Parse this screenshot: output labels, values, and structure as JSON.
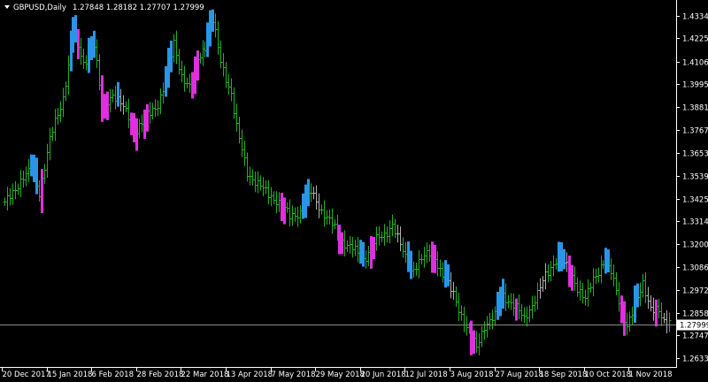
{
  "header": {
    "symbol": "GBPUSD,Daily",
    "ohlc": "1.27848 1.28182 1.27707 1.27999"
  },
  "colors": {
    "background": "#000000",
    "bar_normal": "#22b122",
    "bar_up_signal": "#2a95e6",
    "bar_down_signal": "#e02ee0",
    "bar_neutral": "#b0b0b0",
    "axis": "#ffffff",
    "current_price_line": "#8a8a8a",
    "current_price_label_bg": "#ffffff",
    "current_price_label_text": "#000000"
  },
  "chart_data": {
    "type": "ohlc",
    "ylim": [
      1.2595,
      1.4405
    ],
    "price_ticks": [
      "1.43347",
      "1.42257",
      "1.41067",
      "1.39957",
      "1.38817",
      "1.37677",
      "1.36537",
      "1.35397",
      "1.34257",
      "1.33147",
      "1.32007",
      "1.30867",
      "1.29727",
      "1.28587",
      "1.27477",
      "1.26337"
    ],
    "current_price": "1.27999",
    "date_ticks": [
      "20 Dec 2017",
      "15 Jan 2018",
      "6 Feb 2018",
      "28 Feb 2018",
      "22 Mar 2018",
      "13 Apr 2018",
      "7 May 2018",
      "29 May 2018",
      "20 Jun 2018",
      "12 Jul 2018",
      "3 Aug 2018",
      "27 Aug 2018",
      "18 Sep 2018",
      "10 Oct 2018",
      "1 Nov 2018"
    ],
    "anchors": [
      {
        "i": 0,
        "p": 1.34
      },
      {
        "i": 6,
        "p": 1.352
      },
      {
        "i": 10,
        "p": 1.357
      },
      {
        "i": 13,
        "p": 1.346
      },
      {
        "i": 17,
        "p": 1.372
      },
      {
        "i": 22,
        "p": 1.393
      },
      {
        "i": 26,
        "p": 1.426
      },
      {
        "i": 30,
        "p": 1.41
      },
      {
        "i": 34,
        "p": 1.419
      },
      {
        "i": 37,
        "p": 1.389
      },
      {
        "i": 41,
        "p": 1.395
      },
      {
        "i": 46,
        "p": 1.386
      },
      {
        "i": 50,
        "p": 1.377
      },
      {
        "i": 54,
        "p": 1.384
      },
      {
        "i": 58,
        "p": 1.39
      },
      {
        "i": 61,
        "p": 1.401
      },
      {
        "i": 64,
        "p": 1.42
      },
      {
        "i": 67,
        "p": 1.404
      },
      {
        "i": 70,
        "p": 1.398
      },
      {
        "i": 73,
        "p": 1.412
      },
      {
        "i": 76,
        "p": 1.419
      },
      {
        "i": 79,
        "p": 1.431
      },
      {
        "i": 82,
        "p": 1.411
      },
      {
        "i": 86,
        "p": 1.395
      },
      {
        "i": 88,
        "p": 1.378
      },
      {
        "i": 92,
        "p": 1.356
      },
      {
        "i": 96,
        "p": 1.35
      },
      {
        "i": 100,
        "p": 1.345
      },
      {
        "i": 104,
        "p": 1.341
      },
      {
        "i": 108,
        "p": 1.334
      },
      {
        "i": 112,
        "p": 1.336
      },
      {
        "i": 116,
        "p": 1.346
      },
      {
        "i": 120,
        "p": 1.337
      },
      {
        "i": 124,
        "p": 1.33
      },
      {
        "i": 128,
        "p": 1.322
      },
      {
        "i": 132,
        "p": 1.318
      },
      {
        "i": 136,
        "p": 1.312
      },
      {
        "i": 140,
        "p": 1.322
      },
      {
        "i": 144,
        "p": 1.324
      },
      {
        "i": 147,
        "p": 1.331
      },
      {
        "i": 151,
        "p": 1.316
      },
      {
        "i": 154,
        "p": 1.307
      },
      {
        "i": 158,
        "p": 1.313
      },
      {
        "i": 162,
        "p": 1.316
      },
      {
        "i": 166,
        "p": 1.305
      },
      {
        "i": 170,
        "p": 1.295
      },
      {
        "i": 173,
        "p": 1.285
      },
      {
        "i": 176,
        "p": 1.276
      },
      {
        "i": 179,
        "p": 1.269
      },
      {
        "i": 182,
        "p": 1.28
      },
      {
        "i": 186,
        "p": 1.284
      },
      {
        "i": 189,
        "p": 1.295
      },
      {
        "i": 193,
        "p": 1.29
      },
      {
        "i": 197,
        "p": 1.283
      },
      {
        "i": 201,
        "p": 1.293
      },
      {
        "i": 205,
        "p": 1.304
      },
      {
        "i": 209,
        "p": 1.313
      },
      {
        "i": 213,
        "p": 1.309
      },
      {
        "i": 217,
        "p": 1.299
      },
      {
        "i": 220,
        "p": 1.293
      },
      {
        "i": 223,
        "p": 1.302
      },
      {
        "i": 227,
        "p": 1.312
      },
      {
        "i": 230,
        "p": 1.306
      },
      {
        "i": 233,
        "p": 1.292
      },
      {
        "i": 236,
        "p": 1.28
      },
      {
        "i": 239,
        "p": 1.289
      },
      {
        "i": 242,
        "p": 1.301
      },
      {
        "i": 245,
        "p": 1.289
      },
      {
        "i": 248,
        "p": 1.286
      },
      {
        "i": 250,
        "p": 1.281
      },
      {
        "i": 252,
        "p": 1.283
      }
    ],
    "num_bars": 253,
    "signals_up": [
      [
        10,
        12
      ],
      [
        25,
        27
      ],
      [
        32,
        34
      ],
      [
        43,
        43
      ],
      [
        61,
        63
      ],
      [
        77,
        79
      ],
      [
        113,
        115
      ],
      [
        135,
        136
      ],
      [
        153,
        154
      ],
      [
        167,
        168
      ],
      [
        187,
        189
      ],
      [
        210,
        212
      ],
      [
        228,
        229
      ],
      [
        239,
        240
      ]
    ],
    "signals_down": [
      [
        14,
        14
      ],
      [
        28,
        28
      ],
      [
        37,
        39
      ],
      [
        48,
        50
      ],
      [
        53,
        54
      ],
      [
        71,
        73
      ],
      [
        105,
        106
      ],
      [
        127,
        128
      ],
      [
        139,
        140
      ],
      [
        162,
        163
      ],
      [
        177,
        178
      ],
      [
        187,
        187
      ],
      [
        194,
        194
      ],
      [
        214,
        215
      ],
      [
        234,
        235
      ],
      [
        247,
        247
      ]
    ],
    "neutral_bars": [
      [
        44,
        45
      ],
      [
        78,
        79
      ],
      [
        117,
        119
      ],
      [
        149,
        150
      ],
      [
        169,
        170
      ],
      [
        203,
        205
      ],
      [
        213,
        214
      ],
      [
        244,
        246
      ],
      [
        250,
        251
      ]
    ]
  }
}
